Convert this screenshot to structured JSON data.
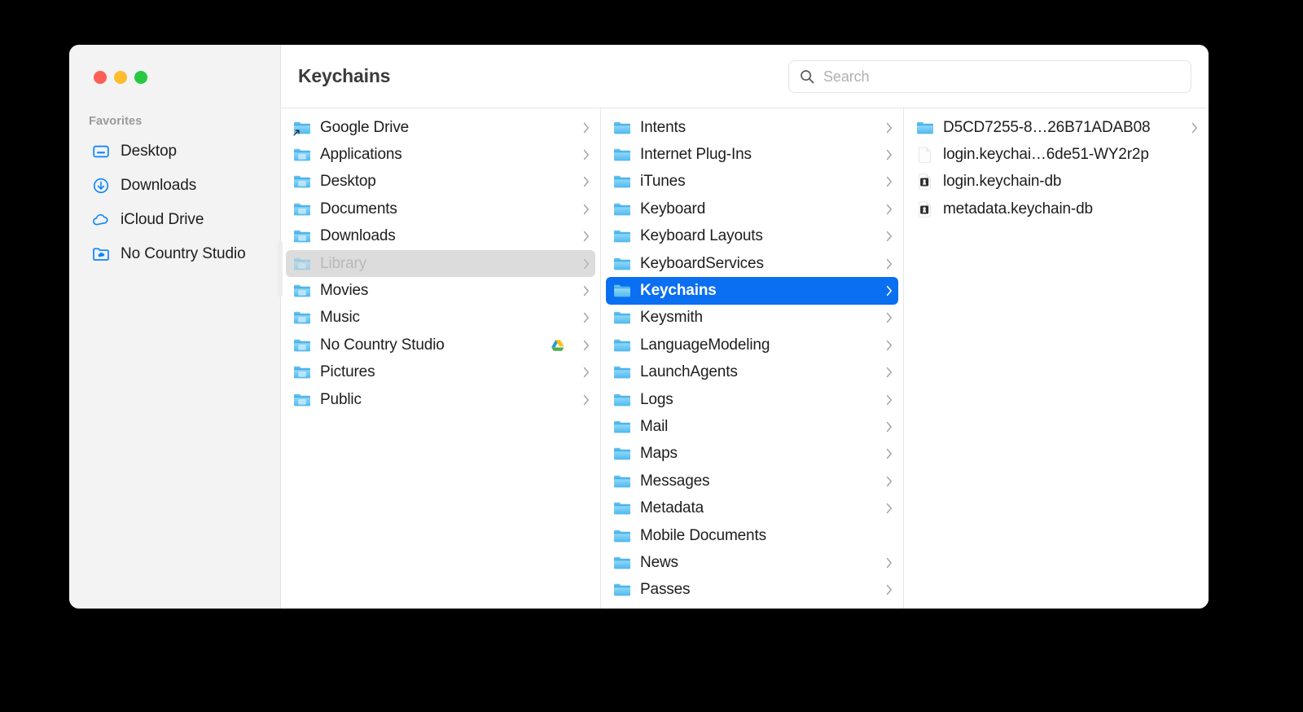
{
  "window": {
    "title": "Keychains",
    "traffic_lights": [
      {
        "name": "close",
        "color": "#ff5f57"
      },
      {
        "name": "minimize",
        "color": "#febc2e"
      },
      {
        "name": "zoom",
        "color": "#28c840"
      }
    ]
  },
  "search": {
    "placeholder": "Search",
    "value": "",
    "icon": "search-icon"
  },
  "sidebar": {
    "section_title": "Favorites",
    "items": [
      {
        "label": "Desktop",
        "icon": "desktop-icon"
      },
      {
        "label": "Downloads",
        "icon": "downloads-icon"
      },
      {
        "label": "iCloud Drive",
        "icon": "icloud-icon"
      },
      {
        "label": "No Country Studio",
        "icon": "folder-cloud-icon"
      }
    ]
  },
  "columns": [
    {
      "name": "column-home",
      "rows": [
        {
          "label": "Google Drive",
          "icon": "folder-alias-icon",
          "chevron": true,
          "state": "normal"
        },
        {
          "label": "Applications",
          "icon": "folder-applications-icon",
          "chevron": true,
          "state": "normal"
        },
        {
          "label": "Desktop",
          "icon": "folder-desktop-icon",
          "chevron": true,
          "state": "normal"
        },
        {
          "label": "Documents",
          "icon": "folder-documents-icon",
          "chevron": true,
          "state": "normal"
        },
        {
          "label": "Downloads",
          "icon": "folder-downloads-icon",
          "chevron": true,
          "state": "normal"
        },
        {
          "label": "Library",
          "icon": "folder-library-icon",
          "chevron": true,
          "state": "selected-inactive"
        },
        {
          "label": "Movies",
          "icon": "folder-movies-icon",
          "chevron": true,
          "state": "normal"
        },
        {
          "label": "Music",
          "icon": "folder-music-icon",
          "chevron": true,
          "state": "normal"
        },
        {
          "label": "No Country Studio",
          "icon": "folder-cloud-icon",
          "chevron": true,
          "state": "normal",
          "badge": "google-drive-badge-icon"
        },
        {
          "label": "Pictures",
          "icon": "folder-pictures-icon",
          "chevron": true,
          "state": "normal"
        },
        {
          "label": "Public",
          "icon": "folder-public-icon",
          "chevron": true,
          "state": "normal"
        }
      ]
    },
    {
      "name": "column-library",
      "rows": [
        {
          "label": "Intents",
          "icon": "folder-icon",
          "chevron": true,
          "state": "normal"
        },
        {
          "label": "Internet Plug-Ins",
          "icon": "folder-icon",
          "chevron": true,
          "state": "normal"
        },
        {
          "label": "iTunes",
          "icon": "folder-icon",
          "chevron": true,
          "state": "normal"
        },
        {
          "label": "Keyboard",
          "icon": "folder-icon",
          "chevron": true,
          "state": "normal"
        },
        {
          "label": "Keyboard Layouts",
          "icon": "folder-icon",
          "chevron": true,
          "state": "normal"
        },
        {
          "label": "KeyboardServices",
          "icon": "folder-icon",
          "chevron": true,
          "state": "normal"
        },
        {
          "label": "Keychains",
          "icon": "folder-icon",
          "chevron": true,
          "state": "selected-active"
        },
        {
          "label": "Keysmith",
          "icon": "folder-icon",
          "chevron": true,
          "state": "normal"
        },
        {
          "label": "LanguageModeling",
          "icon": "folder-icon",
          "chevron": true,
          "state": "normal"
        },
        {
          "label": "LaunchAgents",
          "icon": "folder-icon",
          "chevron": true,
          "state": "normal"
        },
        {
          "label": "Logs",
          "icon": "folder-icon",
          "chevron": true,
          "state": "normal"
        },
        {
          "label": "Mail",
          "icon": "folder-icon",
          "chevron": true,
          "state": "normal"
        },
        {
          "label": "Maps",
          "icon": "folder-icon",
          "chevron": true,
          "state": "normal"
        },
        {
          "label": "Messages",
          "icon": "folder-icon",
          "chevron": true,
          "state": "normal"
        },
        {
          "label": "Metadata",
          "icon": "folder-icon",
          "chevron": true,
          "state": "normal"
        },
        {
          "label": "Mobile Documents",
          "icon": "folder-icon",
          "chevron": false,
          "state": "normal"
        },
        {
          "label": "News",
          "icon": "folder-icon",
          "chevron": true,
          "state": "normal"
        },
        {
          "label": "Passes",
          "icon": "folder-icon",
          "chevron": true,
          "state": "normal"
        }
      ]
    },
    {
      "name": "column-keychains",
      "rows": [
        {
          "label": "D5CD7255-8…26B71ADAB08",
          "icon": "folder-icon",
          "chevron": true,
          "state": "normal"
        },
        {
          "label": "login.keychai…6de51-WY2r2p",
          "icon": "generic-file-icon",
          "chevron": false,
          "state": "normal"
        },
        {
          "label": "login.keychain-db",
          "icon": "keychain-db-file-icon",
          "chevron": false,
          "state": "normal"
        },
        {
          "label": "metadata.keychain-db",
          "icon": "keychain-db-file-icon",
          "chevron": false,
          "state": "normal"
        }
      ]
    }
  ],
  "colors": {
    "selection_active": "#0a6ff0",
    "selection_inactive": "#dcdcdc",
    "folder_blue": "#5ac4f2",
    "accent_blue": "#0a84ff",
    "sidebar_bg": "#f3f3f3",
    "window_bg": "#ffffff"
  }
}
